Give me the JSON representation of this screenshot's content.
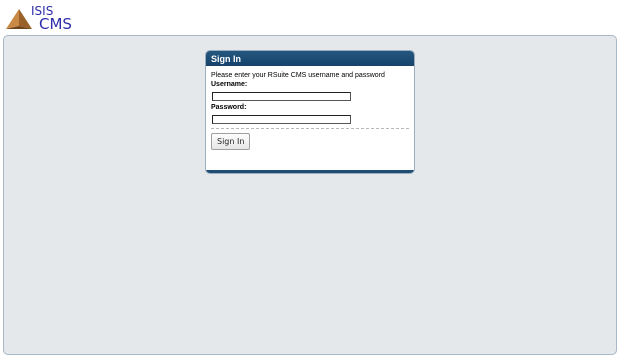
{
  "logo": {
    "top_text": "ISIS",
    "bottom_text": "CMS"
  },
  "signin": {
    "title": "Sign In",
    "instruction": "Please enter your RSuite CMS username and password",
    "username_label": "Username:",
    "username_value": "",
    "password_label": "Password:",
    "password_value": "",
    "button_label": "Sign In"
  },
  "colors": {
    "header_blue": "#1e4c74",
    "panel_bg": "#e4e8ea",
    "logo_text": "#2c2ca8",
    "logo_pyramid": "#b87a3a"
  },
  "icons": {
    "logo_mark": "pyramid-icon"
  }
}
